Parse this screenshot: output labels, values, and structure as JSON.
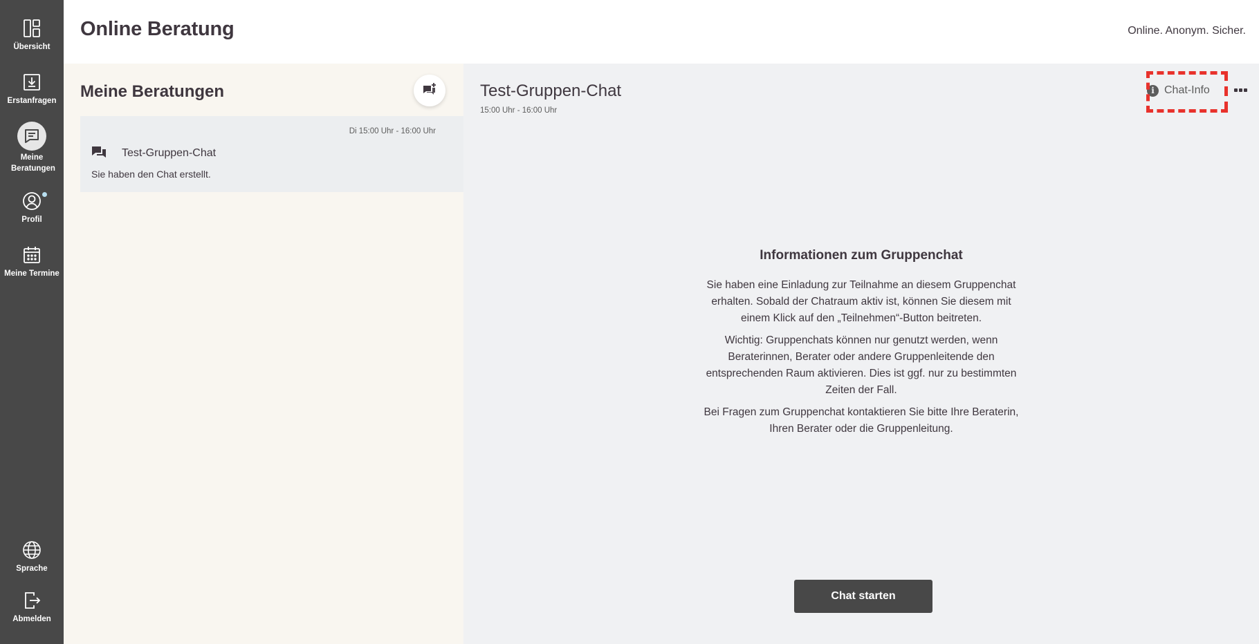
{
  "sidebar": {
    "items": [
      {
        "label": "Übersicht",
        "icon": "dashboard-icon"
      },
      {
        "label": "Erstanfragen",
        "icon": "inbox-download-icon"
      },
      {
        "label": "Meine Beratungen",
        "icon": "chat-lines-icon",
        "active": true
      },
      {
        "label": "Profil",
        "icon": "user-circle-icon",
        "notification": true
      },
      {
        "label": "Meine Termine",
        "icon": "calendar-icon"
      }
    ],
    "bottom": [
      {
        "label": "Sprache",
        "icon": "globe-icon"
      },
      {
        "label": "Abmelden",
        "icon": "logout-icon"
      }
    ],
    "colors": {
      "background": "#484848",
      "notification_dot": "#b8dff0"
    }
  },
  "header": {
    "title": "Online Beratung",
    "claim": "Online. Anonym. Sicher."
  },
  "session_list": {
    "title": "Meine Beratungen",
    "new_chat_icon": "create-group-chat-icon",
    "items": [
      {
        "date": "Di 15:00 Uhr - 16:00 Uhr",
        "name": "Test-Gruppen-Chat",
        "message": "Sie haben den Chat erstellt.",
        "icon": "group-chat-icon"
      }
    ]
  },
  "chat": {
    "title": "Test-Gruppen-Chat",
    "time": "15:00 Uhr - 16:00 Uhr",
    "info_label": "Chat-Info",
    "highlight_color": "#e8322c",
    "info_heading": "Informationen zum Gruppenchat",
    "paragraphs": [
      "Sie haben eine Einladung zur Teilnahme an diesem Gruppenchat erhalten. Sobald der Chatraum aktiv ist, können Sie diesem mit einem Klick auf den „Teilnehmen“-Button beitreten.",
      "Wichtig: Gruppenchats können nur genutzt werden, wenn Beraterinnen, Berater oder andere Gruppenleitende den entsprechenden Raum aktivieren. Dies ist ggf. nur zu bestimmten Zeiten der Fall.",
      "Bei Fragen zum Gruppenchat kontaktieren Sie bitte Ihre Beraterin, Ihren Berater oder die Gruppenleitung."
    ],
    "start_button": "Chat starten"
  }
}
